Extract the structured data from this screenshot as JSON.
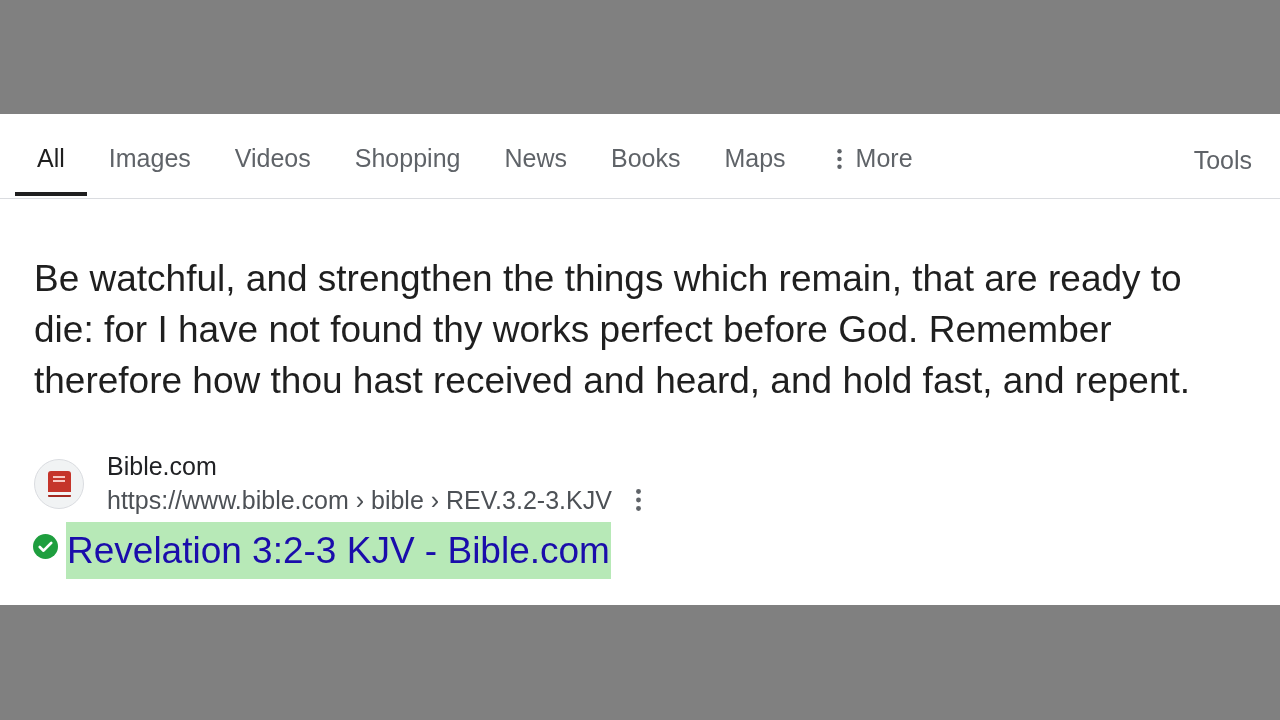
{
  "tabs": [
    {
      "label": "All",
      "selected": true,
      "kind": "tab"
    },
    {
      "label": "Images",
      "selected": false,
      "kind": "tab"
    },
    {
      "label": "Videos",
      "selected": false,
      "kind": "tab"
    },
    {
      "label": "Shopping",
      "selected": false,
      "kind": "tab"
    },
    {
      "label": "News",
      "selected": false,
      "kind": "tab"
    },
    {
      "label": "Books",
      "selected": false,
      "kind": "tab"
    },
    {
      "label": "Maps",
      "selected": false,
      "kind": "tab"
    },
    {
      "label": "More",
      "selected": false,
      "kind": "menu"
    }
  ],
  "tools": "Tools",
  "snippet": "Be watchful, and strengthen the things which remain, that are ready to die: for I have not found thy works perfect before God. Remember therefore how thou hast received and heard, and hold fast, and repent.",
  "result": {
    "site_name": "Bible.com",
    "url": "https://www.bible.com › bible › REV.3.2-3.KJV",
    "title": "Revelation 3:2-3 KJV - Bible.com",
    "verified": true,
    "highlighted": true
  }
}
